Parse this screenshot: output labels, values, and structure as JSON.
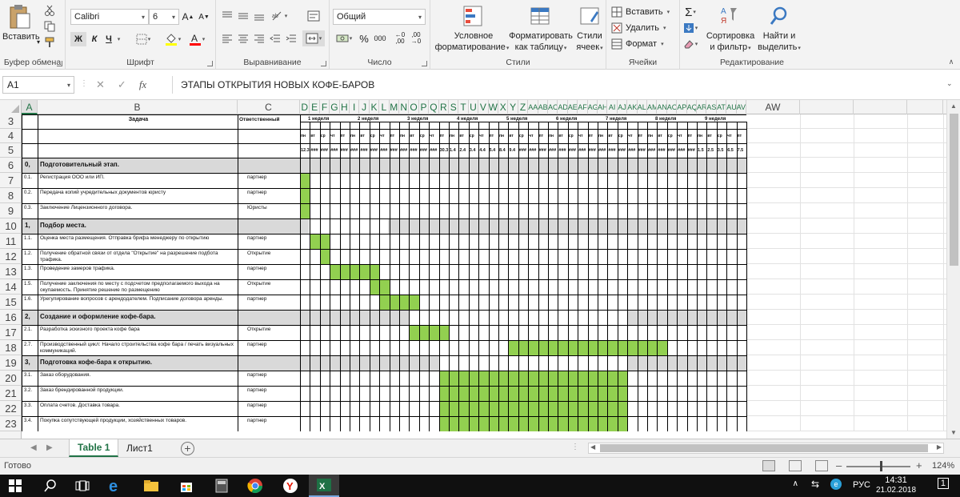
{
  "ribbon": {
    "clipboard": {
      "paste": "Вставить",
      "group": "Буфер обмена"
    },
    "font": {
      "name": "Calibri",
      "size": "6",
      "bold": "Ж",
      "italic": "К",
      "underline": "Ч",
      "group": "Шрифт"
    },
    "alignment": {
      "group": "Выравнивание"
    },
    "number": {
      "format": "Общий",
      "percent": "%",
      "thousands": "000",
      "inc_dec": ",00",
      "dec_dec": ",00",
      "group": "Число"
    },
    "styles": {
      "cond_line1": "Условное",
      "cond_line2": "форматирование",
      "table_line1": "Форматировать",
      "table_line2": "как таблицу",
      "cell_line1": "Стили",
      "cell_line2": "ячеек",
      "group": "Стили"
    },
    "cells": {
      "insert": "Вставить",
      "delete": "Удалить",
      "format": "Формат",
      "group": "Ячейки"
    },
    "editing": {
      "sum": "Σ",
      "sort_line1": "Сортировка",
      "sort_line2": "и фильтр",
      "find_line1": "Найти и",
      "find_line2": "выделить",
      "group": "Редактирование"
    }
  },
  "formula_bar": {
    "name_box": "A1",
    "fx": "fx",
    "value": "ЭТАПЫ ОТКРЫТИЯ НОВЫХ КОФЕ-БАРОВ"
  },
  "columns": [
    "A",
    "B",
    "C",
    "D",
    "E",
    "F",
    "G",
    "H",
    "I",
    "J",
    "K",
    "L",
    "M",
    "N",
    "O",
    "P",
    "Q",
    "R",
    "S",
    "T",
    "U",
    "V",
    "W",
    "X",
    "Y",
    "Z",
    "AA",
    "AB",
    "AC",
    "AD",
    "AE",
    "AF",
    "AG",
    "AH",
    "AI",
    "AJ",
    "AK",
    "AL",
    "AM",
    "AN",
    "AO",
    "AP",
    "AQ",
    "AR",
    "AS",
    "AT",
    "AU",
    "AV",
    "AW"
  ],
  "rows": [
    "3",
    "4",
    "5",
    "6",
    "7",
    "8",
    "9",
    "10",
    "11",
    "12",
    "13",
    "14",
    "15",
    "16",
    "17",
    "18",
    "19",
    "20",
    "21",
    "22",
    "23"
  ],
  "sheet": {
    "hdr_task": "Задача",
    "hdr_resp": "Ответственный",
    "weeks": [
      "1 неделя",
      "2 неделя",
      "3 неделя",
      "4 неделя",
      "5 неделя",
      "6 неделя",
      "7 неделя",
      "8 неделя",
      "9 неделя"
    ],
    "days": [
      "пн",
      "вт",
      "ср",
      "чт",
      "пт"
    ],
    "dates": [
      "12.3",
      "###",
      "###",
      "###",
      "###",
      "###",
      "###",
      "###",
      "###",
      "###",
      "###",
      "###",
      "###",
      "###",
      "30.3",
      "1.4",
      "2.4",
      "3.4",
      "4.4",
      "5.4",
      "8.4",
      "9.4",
      "###",
      "###",
      "###",
      "###",
      "###",
      "###",
      "###",
      "###",
      "###",
      "###",
      "###",
      "###",
      "###",
      "###",
      "###",
      "###",
      "###",
      "###",
      "1.5",
      "2.5",
      "3.5",
      "6.5",
      "7.5"
    ],
    "sections": [
      {
        "num": "0,",
        "title": "Подготовительный этап."
      },
      {
        "num": "1,",
        "title": "Подбор места."
      },
      {
        "num": "2,",
        "title": "Создание и оформление кофе-бара."
      },
      {
        "num": "3,",
        "title": "Подготовка кофе-бара к открытию."
      }
    ],
    "tasks": [
      {
        "num": "0.1.",
        "text": "Регистрация ООО или ИП.",
        "resp": "партнер"
      },
      {
        "num": "0.2.",
        "text": "Передача копий учредительных документов юристу",
        "resp": "партнер"
      },
      {
        "num": "0.3.",
        "text": "Заключение Лицензионного договора.",
        "resp": "Юристы"
      },
      {
        "num": "1.1.",
        "text": "Оценка места размещения. Отправка брифа менеджеру по открытию",
        "resp": "партнер"
      },
      {
        "num": "1.2.",
        "text": "Получение обратной связи от отдела \"Открытие\" на разрешение подбота трафика.",
        "resp": "Открытие"
      },
      {
        "num": "1.3.",
        "text": "Проведение замеров трафика.",
        "resp": "партнер"
      },
      {
        "num": "1.5.",
        "text": "Получение заключения по месту с подсчетом предполагаемого выхода на окупаемость. Принятие решение по размещению",
        "resp": "Открытие"
      },
      {
        "num": "1.6.",
        "text": "Урегулирование вопросов с арендодателем. Подписание договора аренды.",
        "resp": "партнер"
      },
      {
        "num": "2.1.",
        "text": "Разработка эскизного проекта кофе бара",
        "resp": "Открытие"
      },
      {
        "num": "2.7.",
        "text": "Производственный цикл: Начало строительства кофе бара / печать визуальных коммуникаций.",
        "resp": "партнер"
      },
      {
        "num": "3.1.",
        "text": "Заказ оборудования.",
        "resp": "партнер"
      },
      {
        "num": "3.2.",
        "text": "Заказ брендированной продукции.",
        "resp": "партнер"
      },
      {
        "num": "3.3.",
        "text": "Оплата счетов. Доставка товара.",
        "resp": "партнер"
      },
      {
        "num": "3.4.",
        "text": "Покупка сопутствующей продукции, хозяйственных товаров.",
        "resp": "партнер"
      }
    ]
  },
  "tabs": {
    "active": "Table 1",
    "other": "Лист1",
    "add": "+"
  },
  "status": {
    "ready": "Готово",
    "zoom": "124%"
  },
  "taskbar": {
    "lang": "РУС",
    "time": "14:31",
    "date": "21.02.2018",
    "notif": "1"
  },
  "colors": {
    "excel_green": "#217346",
    "gantt_green": "#92d050",
    "section_grey": "#d9d9d9"
  }
}
